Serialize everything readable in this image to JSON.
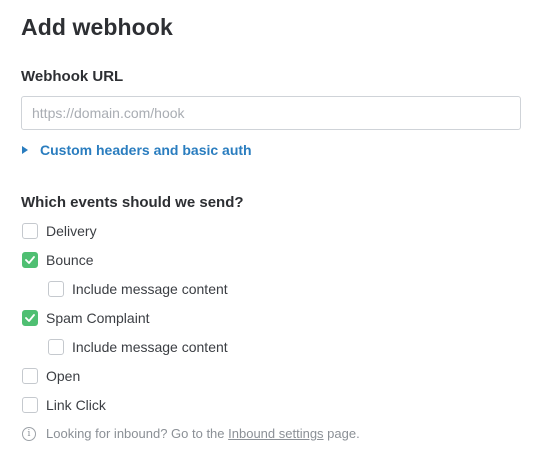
{
  "page": {
    "title": "Add webhook"
  },
  "url_field": {
    "label": "Webhook URL",
    "value": "",
    "placeholder": "https://domain.com/hook"
  },
  "advanced": {
    "label": "Custom headers and basic auth",
    "expanded": false,
    "icon": "triangle-right-icon"
  },
  "events": {
    "heading": "Which events should we send?",
    "items": [
      {
        "label": "Delivery",
        "checked": false
      },
      {
        "label": "Bounce",
        "checked": true
      },
      {
        "label": "Include message content",
        "checked": false
      },
      {
        "label": "Spam Complaint",
        "checked": true
      },
      {
        "label": "Include message content",
        "checked": false
      },
      {
        "label": "Open",
        "checked": false
      },
      {
        "label": "Link Click",
        "checked": false
      }
    ]
  },
  "footnote": {
    "icon": "info-icon",
    "text_before": "Looking for inbound? Go to the ",
    "link_text": "Inbound settings",
    "text_after": " page."
  },
  "colors": {
    "link": "#2a7dbf",
    "checked": "#4fbf72"
  }
}
